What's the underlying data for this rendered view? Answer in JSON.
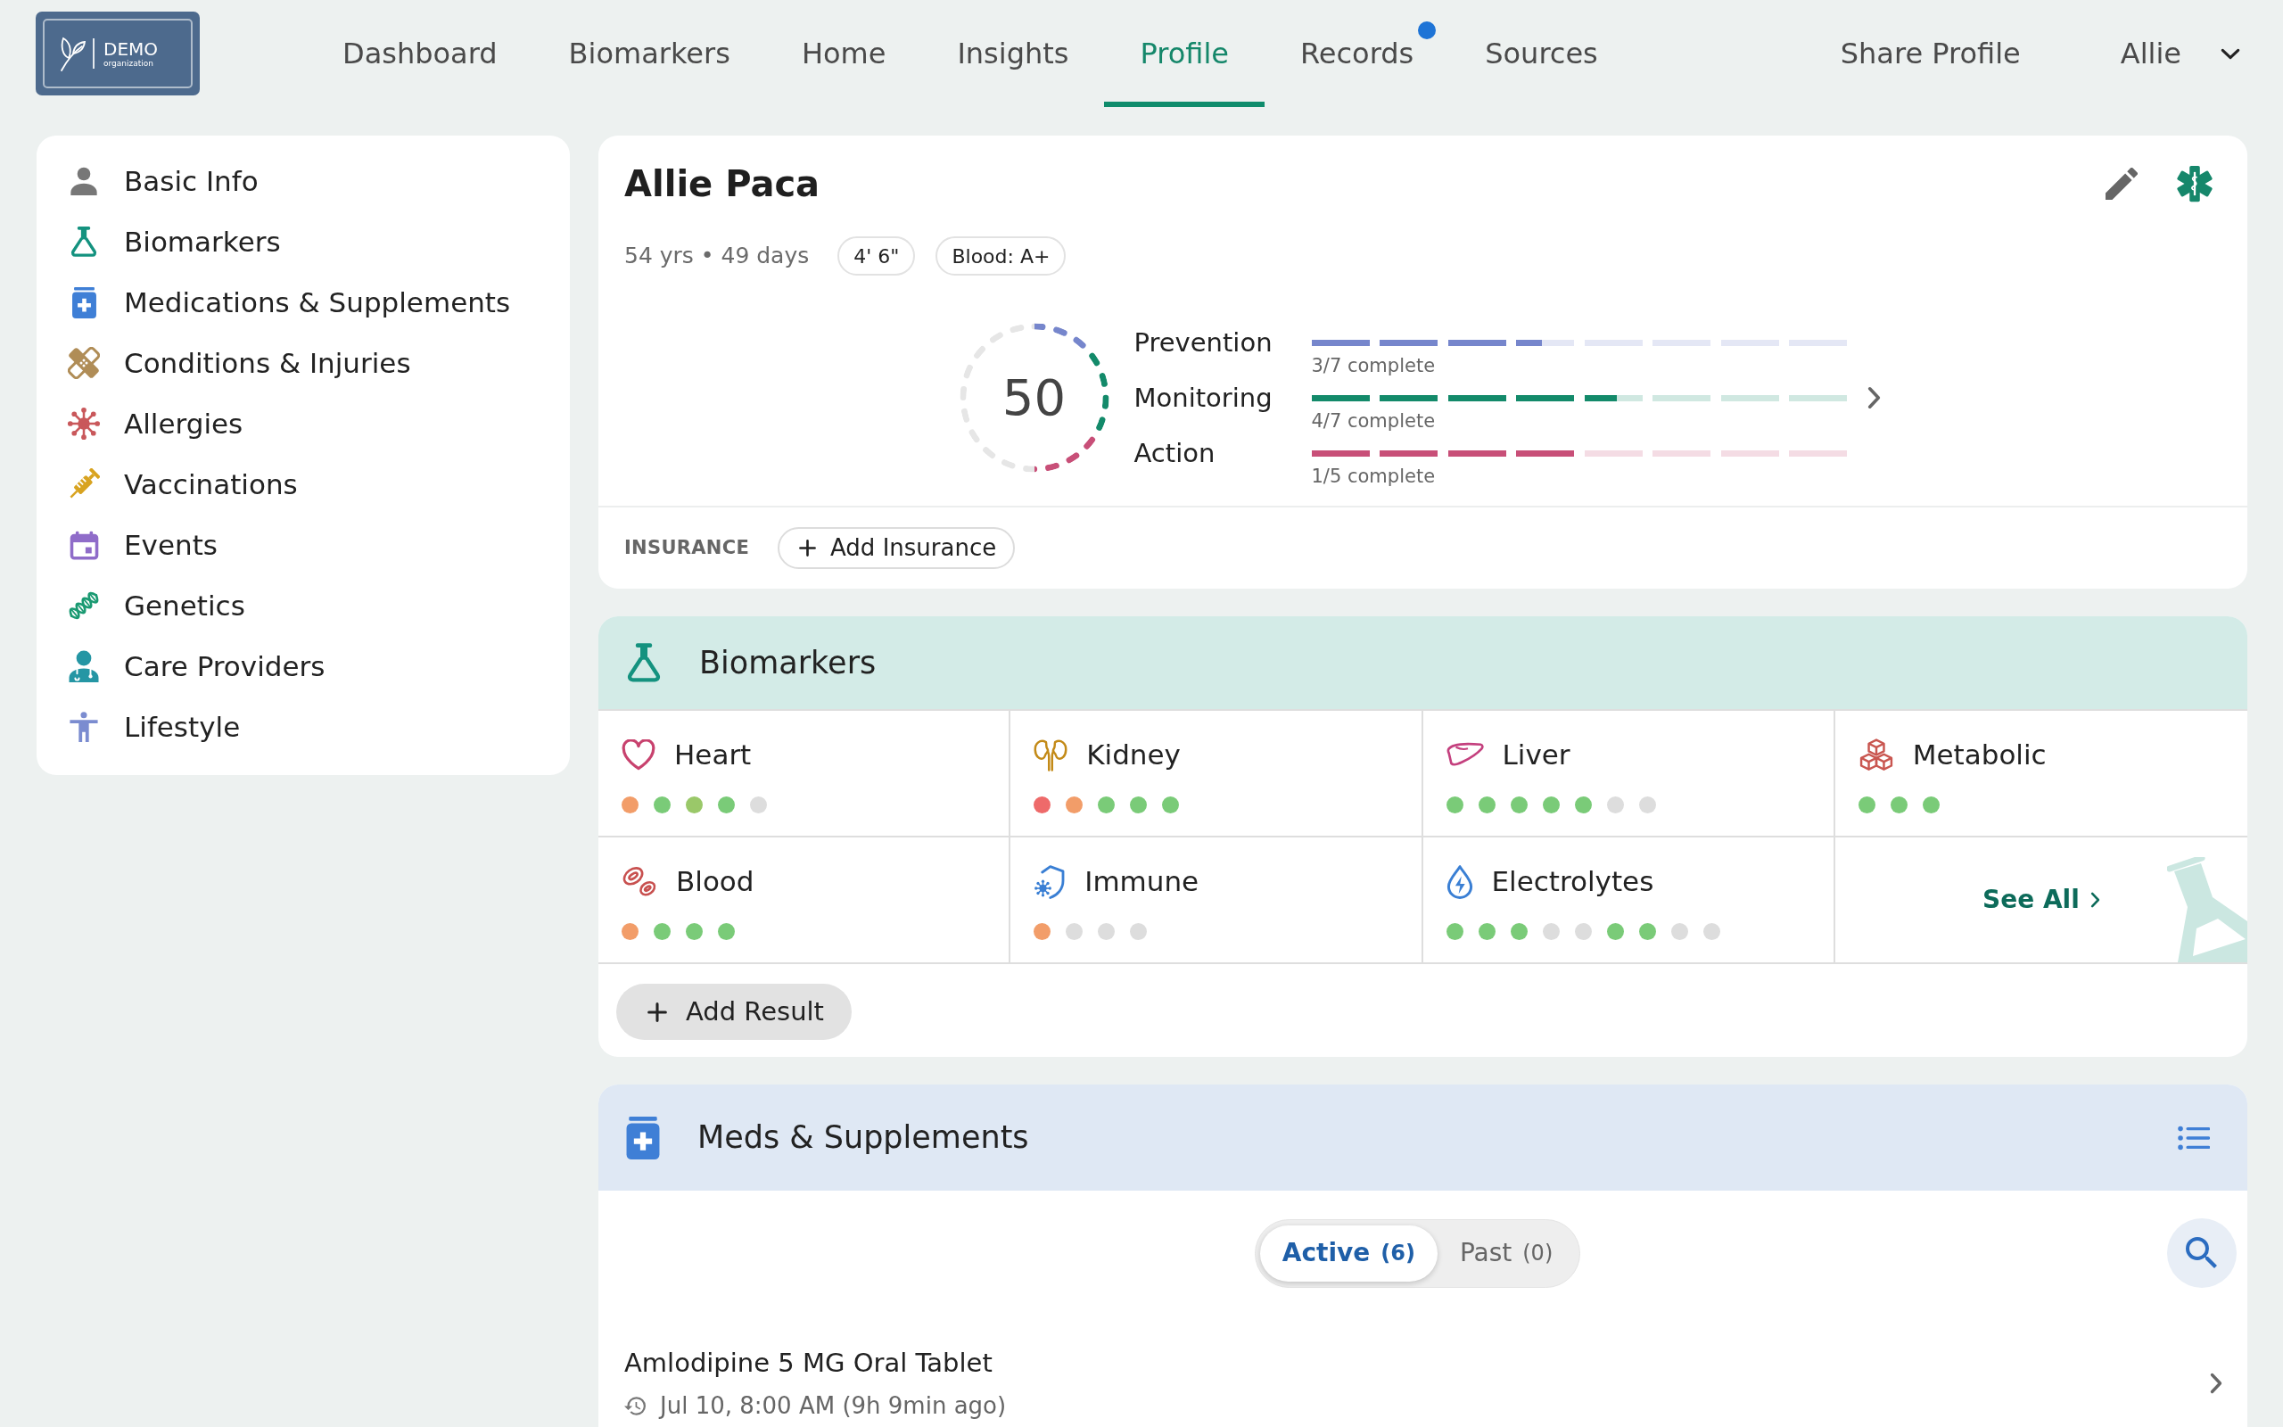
{
  "header": {
    "logo": {
      "title": "DEMO",
      "subtitle": "organization"
    },
    "nav": [
      {
        "label": "Dashboard",
        "selected": false,
        "notification": false
      },
      {
        "label": "Biomarkers",
        "selected": false,
        "notification": false
      },
      {
        "label": "Home",
        "selected": false,
        "notification": false
      },
      {
        "label": "Insights",
        "selected": false,
        "notification": false
      },
      {
        "label": "Profile",
        "selected": true,
        "notification": false
      },
      {
        "label": "Records",
        "selected": false,
        "notification": true
      },
      {
        "label": "Sources",
        "selected": false,
        "notification": false
      }
    ],
    "share_link": "Share Profile",
    "user_menu": "Allie"
  },
  "sidebar": {
    "items": [
      {
        "label": "Basic Info"
      },
      {
        "label": "Biomarkers"
      },
      {
        "label": "Medications & Supplements"
      },
      {
        "label": "Conditions & Injuries"
      },
      {
        "label": "Allergies"
      },
      {
        "label": "Vaccinations"
      },
      {
        "label": "Events"
      },
      {
        "label": "Genetics"
      },
      {
        "label": "Care Providers"
      },
      {
        "label": "Lifestyle"
      }
    ]
  },
  "profile": {
    "name": "Allie Paca",
    "age": "54 yrs • 49 days",
    "tags": [
      "4' 6\"",
      "Blood: A+"
    ],
    "score": {
      "value": "50",
      "level": 0.5
    },
    "categories": [
      {
        "label": "Prevention",
        "level": 0.43,
        "progress": "3/7 complete",
        "color": "#7686cc"
      },
      {
        "label": "Monitoring",
        "level": 0.57,
        "progress": "4/7 complete",
        "color": "#138a6a"
      },
      {
        "label": "Action",
        "level": 0.5,
        "progress": "1/5 complete",
        "color": "#c84f78"
      }
    ],
    "insurance": {
      "label": "INSURANCE",
      "button": "Add Insurance"
    }
  },
  "biomarkers": {
    "title": "Biomarkers",
    "panels": [
      {
        "name": "Heart",
        "dots": [
          {
            "color": "#f29d69"
          },
          {
            "color": "#7acb78"
          },
          {
            "color": "#9ac869"
          },
          {
            "color": "#7acb78"
          },
          {
            "color": "#dddddd"
          }
        ]
      },
      {
        "name": "Kidney",
        "dots": [
          {
            "color": "#ee6a6a"
          },
          {
            "color": "#f29d69"
          },
          {
            "color": "#7acb78"
          },
          {
            "color": "#7acb78"
          },
          {
            "color": "#7acb78"
          }
        ]
      },
      {
        "name": "Liver",
        "dots": [
          {
            "color": "#7acb78"
          },
          {
            "color": "#7acb78"
          },
          {
            "color": "#7acb78"
          },
          {
            "color": "#7acb78"
          },
          {
            "color": "#7acb78"
          },
          {
            "color": "#dddddd"
          },
          {
            "color": "#dddddd"
          }
        ]
      },
      {
        "name": "Metabolic",
        "dots": [
          {
            "color": "#7acb78"
          },
          {
            "color": "#7acb78"
          },
          {
            "color": "#7acb78"
          }
        ]
      },
      {
        "name": "Blood",
        "dots": [
          {
            "color": "#f29d69"
          },
          {
            "color": "#7acb78"
          },
          {
            "color": "#7acb78"
          },
          {
            "color": "#7acb78"
          }
        ]
      },
      {
        "name": "Immune",
        "dots": [
          {
            "color": "#f29d69"
          },
          {
            "color": "#dddddd"
          },
          {
            "color": "#dddddd"
          },
          {
            "color": "#dddddd"
          }
        ]
      },
      {
        "name": "Electrolytes",
        "dots": [
          {
            "color": "#7acb78"
          },
          {
            "color": "#7acb78"
          },
          {
            "color": "#7acb78"
          },
          {
            "color": "#dddddd"
          },
          {
            "color": "#dddddd"
          },
          {
            "color": "#7acb78"
          },
          {
            "color": "#7acb78"
          },
          {
            "color": "#dddddd"
          },
          {
            "color": "#dddddd"
          }
        ]
      }
    ],
    "see_all": "See All",
    "add_button": "Add Result"
  },
  "meds": {
    "title": "Meds & Supplements",
    "tabs": [
      {
        "label": "Active",
        "count": "(6)",
        "selected": true
      },
      {
        "label": "Past",
        "count": "(0)",
        "selected": false
      }
    ],
    "items": [
      {
        "name": "Amlodipine 5 MG Oral Tablet",
        "time": "Jul 10, 8:00 AM (9h 9min ago)"
      }
    ]
  }
}
